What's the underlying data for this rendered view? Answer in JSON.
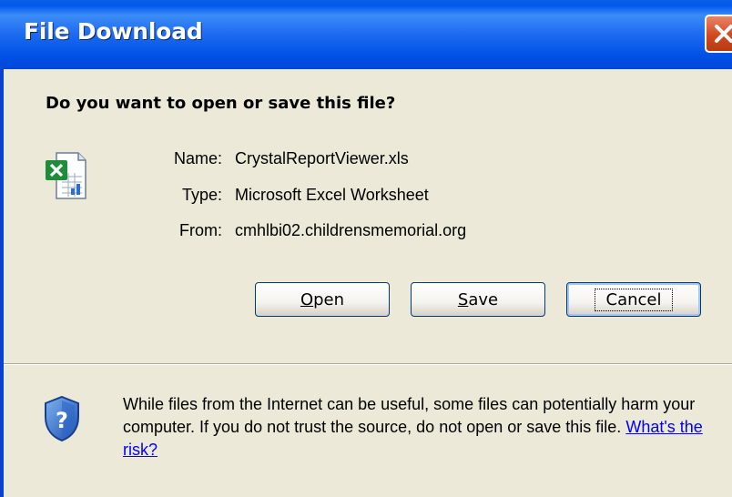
{
  "window": {
    "title": "File Download",
    "close_icon": "close-icon"
  },
  "dialog": {
    "question": "Do you want to open or save this file?",
    "file_icon": "excel-file-icon",
    "properties": [
      {
        "label": "Name:",
        "value": "CrystalReportViewer.xls"
      },
      {
        "label": "Type:",
        "value": "Microsoft Excel Worksheet"
      },
      {
        "label": "From:",
        "value": "cmhlbi02.childrensmemorial.org"
      }
    ],
    "buttons": {
      "open": {
        "mnemonic": "O",
        "rest": "pen"
      },
      "save": {
        "mnemonic": "S",
        "rest": "ave"
      },
      "cancel": "Cancel"
    },
    "warning": {
      "icon": "shield-help-icon",
      "text": "While files from the Internet can be useful, some files can potentially harm your computer. If you do not trust the source, do not open or save this file. ",
      "link": "What's the risk?"
    }
  },
  "colors": {
    "titlebar": "#0058EE",
    "dialog_bg": "#ECE9D8",
    "close_button": "#D2491E",
    "link": "#0000FF"
  }
}
